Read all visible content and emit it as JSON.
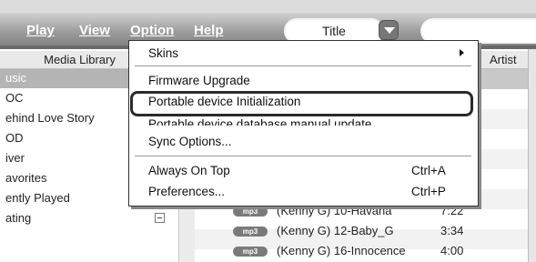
{
  "menubar": {
    "items": [
      "Play",
      "View",
      "Option",
      "Help"
    ],
    "title_field": "Title",
    "search_value": ""
  },
  "library": {
    "header": "Media Library",
    "items": [
      "usic",
      "OC",
      "ehind Love Story",
      "OD",
      "iver",
      "avorites",
      "ently Played",
      "ating"
    ]
  },
  "tracklist": {
    "artist_header": "Artist",
    "badge": "mp3",
    "tracks": [
      {
        "title": "(Kenny G) 10-Havana",
        "time": "7:22"
      },
      {
        "title": "(Kenny G) 12-Baby_G",
        "time": "3:34"
      },
      {
        "title": "(Kenny G) 16-Innocence",
        "time": "4:00"
      }
    ]
  },
  "option_menu": {
    "skins": "Skins",
    "firmware": "Firmware Upgrade",
    "portable_init": "Portable device Initialization",
    "db_update": "Portable device database manual update",
    "sync": "Sync Options...",
    "always_on_top": "Always On Top",
    "always_on_top_shortcut": "Ctrl+A",
    "preferences": "Preferences...",
    "preferences_shortcut": "Ctrl+P"
  },
  "colors": {
    "menubar_top": "#d2d2d2",
    "menubar_bottom": "#7c7c7c",
    "highlight_border": "#2b2b2b",
    "selected_row": "#b4b4b4"
  }
}
